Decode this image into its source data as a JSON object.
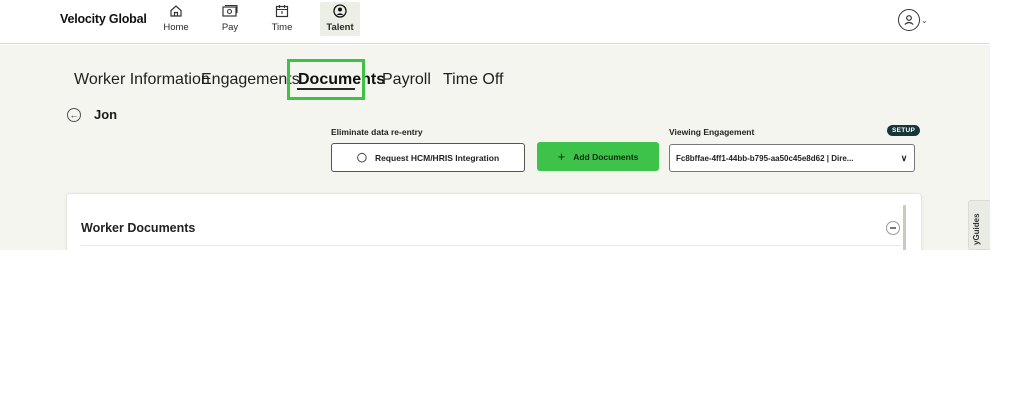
{
  "brand": {
    "name": "Velocity Global"
  },
  "nav": {
    "items": [
      {
        "label": "Home",
        "icon": "home-icon"
      },
      {
        "label": "Pay",
        "icon": "pay-icon"
      },
      {
        "label": "Time",
        "icon": "calendar-icon"
      },
      {
        "label": "Talent",
        "icon": "talent-icon",
        "active": true
      }
    ]
  },
  "user_menu": {
    "icon": "user-avatar-icon"
  },
  "tabs": [
    {
      "label": "Worker Information"
    },
    {
      "label": "Engagements"
    },
    {
      "label": "Documents",
      "active": true
    },
    {
      "label": "Payroll"
    },
    {
      "label": "Time Off"
    }
  ],
  "worker": {
    "name": "Jon"
  },
  "integration": {
    "label": "Eliminate data re-entry",
    "button_label": "Request HCM/HRIS Integration"
  },
  "add_documents": {
    "label": "Add Documents"
  },
  "engagement": {
    "label": "Viewing Engagement",
    "badge": "SETUP",
    "value": "Fc8bffae-4ff1-44bb-b795-aa50c45e8d62 | Dire..."
  },
  "card": {
    "title": "Worker Documents"
  },
  "side_tab": {
    "label": "yGuides"
  },
  "colors": {
    "accent_green": "#3dc24a",
    "highlight_green": "#3fc046",
    "page_bg": "#f4f5ef",
    "badge_bg": "#17363a"
  }
}
